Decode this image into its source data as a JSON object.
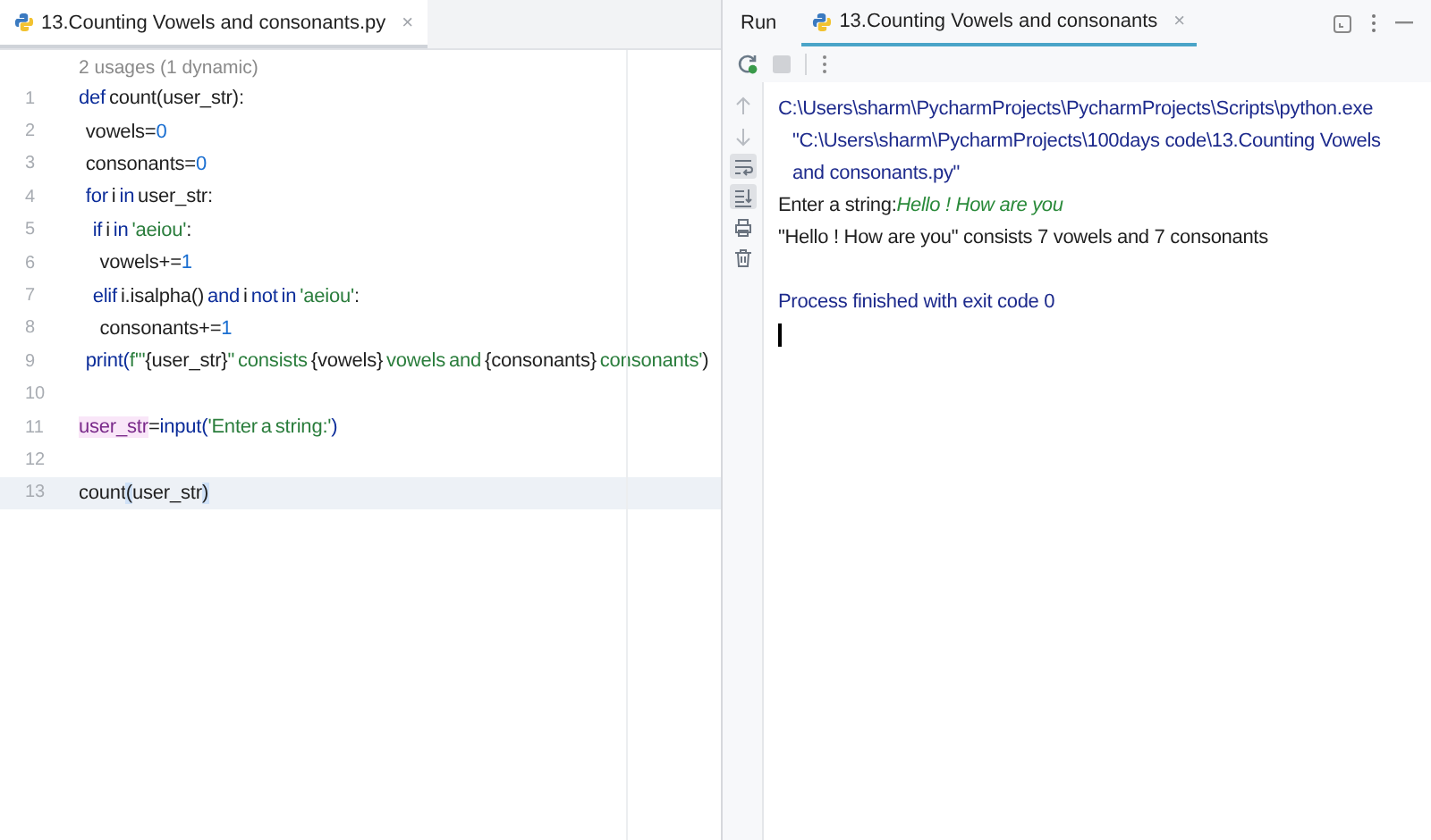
{
  "editor": {
    "tab": {
      "label": "13.Counting Vowels and consonants.py",
      "close": "×",
      "selected": true
    },
    "usages_hint": "2 usages (1 dynamic)",
    "lines": [
      {
        "number": "1",
        "current": false,
        "tokens": [
          {
            "kind": "kw",
            "text": "def "
          },
          {
            "kind": "plain",
            "text": "count("
          },
          {
            "kind": "param",
            "text": "user_str"
          },
          {
            "kind": "plain",
            "text": "):"
          }
        ]
      },
      {
        "number": "2",
        "current": false,
        "tokens": [
          {
            "kind": "plain",
            "text": "  vowels="
          },
          {
            "kind": "num",
            "text": "0"
          }
        ]
      },
      {
        "number": "3",
        "current": false,
        "tokens": [
          {
            "kind": "plain",
            "text": "  consonants="
          },
          {
            "kind": "num",
            "text": "0"
          }
        ]
      },
      {
        "number": "4",
        "current": false,
        "tokens": [
          {
            "kind": "kw",
            "text": "  for "
          },
          {
            "kind": "plain",
            "text": "i "
          },
          {
            "kind": "kw",
            "text": "in "
          },
          {
            "kind": "plain",
            "text": "user_str:"
          }
        ]
      },
      {
        "number": "5",
        "current": false,
        "tokens": [
          {
            "kind": "kw",
            "text": "    if "
          },
          {
            "kind": "plain",
            "text": "i "
          },
          {
            "kind": "kw",
            "text": "in "
          },
          {
            "kind": "str",
            "text": "'aeiou'"
          },
          {
            "kind": "plain",
            "text": ":"
          }
        ]
      },
      {
        "number": "6",
        "current": false,
        "tokens": [
          {
            "kind": "plain",
            "text": "      vowels+="
          },
          {
            "kind": "num",
            "text": "1"
          }
        ]
      },
      {
        "number": "7",
        "current": false,
        "tokens": [
          {
            "kind": "kw",
            "text": "    elif "
          },
          {
            "kind": "plain",
            "text": "i.isalpha() "
          },
          {
            "kind": "kw",
            "text": "and "
          },
          {
            "kind": "plain",
            "text": "i "
          },
          {
            "kind": "kw",
            "text": "not in "
          },
          {
            "kind": "str",
            "text": "'aeiou'"
          },
          {
            "kind": "plain",
            "text": ":"
          }
        ]
      },
      {
        "number": "8",
        "current": false,
        "tokens": [
          {
            "kind": "plain",
            "text": "      consonants+="
          },
          {
            "kind": "num",
            "text": "1"
          }
        ]
      },
      {
        "number": "9",
        "current": false,
        "tokens": [
          {
            "kind": "builtin",
            "text": "  print("
          },
          {
            "kind": "str",
            "text": "f'\""
          },
          {
            "kind": "plain",
            "text": "{user_str}"
          },
          {
            "kind": "str",
            "text": "\" consists "
          },
          {
            "kind": "plain",
            "text": "{vowels}"
          },
          {
            "kind": "str",
            "text": " vowels and "
          },
          {
            "kind": "plain",
            "text": "{consonants}"
          },
          {
            "kind": "str",
            "text": " consonants'"
          },
          {
            "kind": "plain",
            "text": ")"
          }
        ]
      },
      {
        "number": "10",
        "current": false
      },
      {
        "number": "11",
        "current": false,
        "tokens": [
          {
            "kind": "global",
            "text": "user_str"
          },
          {
            "kind": "plain",
            "text": "="
          },
          {
            "kind": "builtin",
            "text": "input("
          },
          {
            "kind": "str",
            "text": "'Enter a string:'"
          },
          {
            "kind": "builtin",
            "text": ")"
          }
        ]
      },
      {
        "number": "12",
        "current": false
      },
      {
        "number": "13",
        "current": true,
        "tokens": [
          {
            "kind": "plain",
            "text": "count"
          },
          {
            "kind": "brace",
            "text": "("
          },
          {
            "kind": "plain",
            "text": "user_str"
          },
          {
            "kind": "brace",
            "text": ")"
          }
        ]
      }
    ]
  },
  "run": {
    "title": "Run",
    "tab": {
      "label": "13.Counting Vowels and consonants",
      "close": "×",
      "selected": true
    },
    "side_tools": [
      {
        "kind": "up",
        "on": false
      },
      {
        "kind": "down",
        "on": false
      },
      {
        "kind": "wrap",
        "on": true
      },
      {
        "kind": "scroll-end",
        "on": true
      },
      {
        "kind": "print",
        "on": false
      },
      {
        "kind": "trash",
        "on": false
      }
    ],
    "output": [
      {
        "kind": "path",
        "text": "C:\\Users\\sharm\\PycharmProjects\\PycharmProjects\\Scripts\\python.exe"
      },
      {
        "kind": "path-cont",
        "text": "\"C:\\Users\\sharm\\PycharmProjects\\100days code\\13.Counting Vowels and consonants.py\""
      },
      {
        "kind": "prompt",
        "text": "Enter a string:",
        "input": "Hello ! How are you"
      },
      {
        "kind": "stdout",
        "text": "\"Hello ! How are you\" consists 7 vowels and 7 consonants"
      },
      {
        "kind": "blank"
      },
      {
        "kind": "path",
        "text": "Process finished with exit code 0"
      }
    ]
  }
}
